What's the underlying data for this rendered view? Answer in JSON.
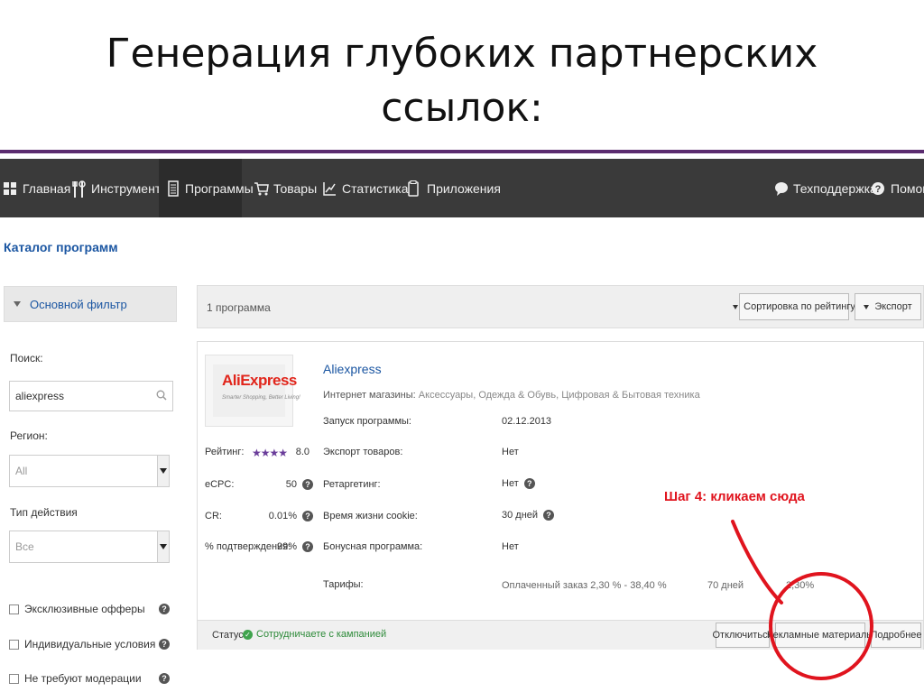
{
  "slide": {
    "title_line1": "Генерация глубоких партнерских",
    "title_line2": "ссылок:"
  },
  "nav": {
    "items": [
      {
        "label": "Главная",
        "icon": "grid-icon"
      },
      {
        "label": "Инструменты",
        "icon": "tools-icon"
      },
      {
        "label": "Программы",
        "icon": "document-icon"
      },
      {
        "label": "Товары",
        "icon": "cart-icon"
      },
      {
        "label": "Статистика",
        "icon": "chart-icon"
      },
      {
        "label": "Приложения",
        "icon": "apps-icon"
      }
    ],
    "support": "Техподдержка",
    "help": "Помощь"
  },
  "breadcrumb": "Каталог программ",
  "sidebar": {
    "filter_title": "Основной фильтр",
    "search_label": "Поиск:",
    "search_value": "aliexpress",
    "region_label": "Регион:",
    "region_value": "All",
    "action_label": "Тип действия",
    "action_value": "Все",
    "checks": [
      {
        "label": "Эксклюзивные офферы"
      },
      {
        "label": "Индивидуальные условия"
      },
      {
        "label": "Не требуют модерации"
      }
    ]
  },
  "results": {
    "count": "1 программа",
    "sort_label": "Сортировка по рейтингу",
    "export_label": "Экспорт"
  },
  "program": {
    "logo_text": "AliExpress",
    "logo_tagline": "Smarter Shopping, Better Living!",
    "name": "Aliexpress",
    "category_label": "Интернет магазины:",
    "categories": "Аксессуары, Одежда & Обувь, Цифровая & Бытовая техника",
    "rating_label": "Рейтинг:",
    "rating_stars": "★★★★",
    "rating_value": "8.0",
    "ecpc_label": "eCPC:",
    "ecpc_value": "50",
    "cr_label": "CR:",
    "cr_value": "0.01%",
    "approval_label": "% подтверждения:",
    "approval_value": "99%",
    "details": [
      {
        "label": "Запуск программы:",
        "value": "02.12.2013"
      },
      {
        "label": "Экспорт товаров:",
        "value": "Нет"
      },
      {
        "label": "Ретаргетинг:",
        "value": "Нет"
      },
      {
        "label": "Время жизни cookie:",
        "value": "30 дней"
      },
      {
        "label": "Бонусная программа:",
        "value": "Нет"
      },
      {
        "label": "Тарифы:",
        "value": "Оплаченный заказ 2,30 % - 38,40 %"
      }
    ],
    "tariff_days": "70 дней",
    "tariff_percent": "2,30%",
    "status_label": "Статус:",
    "status_value": "Сотрудничаете с кампанией",
    "btn_disable": "Отключиться",
    "btn_promo": "Рекламные материалы",
    "btn_more": "Подробнее"
  },
  "annotation": {
    "text": "Шаг 4: кликаем сюда",
    "color": "#e0141e"
  },
  "colors": {
    "navbar": "#3a3a3a",
    "accent_rule": "#5b2c6f",
    "link": "#1b56a2",
    "status_ok": "#2e8b3a",
    "stars": "#6a3d9a"
  }
}
